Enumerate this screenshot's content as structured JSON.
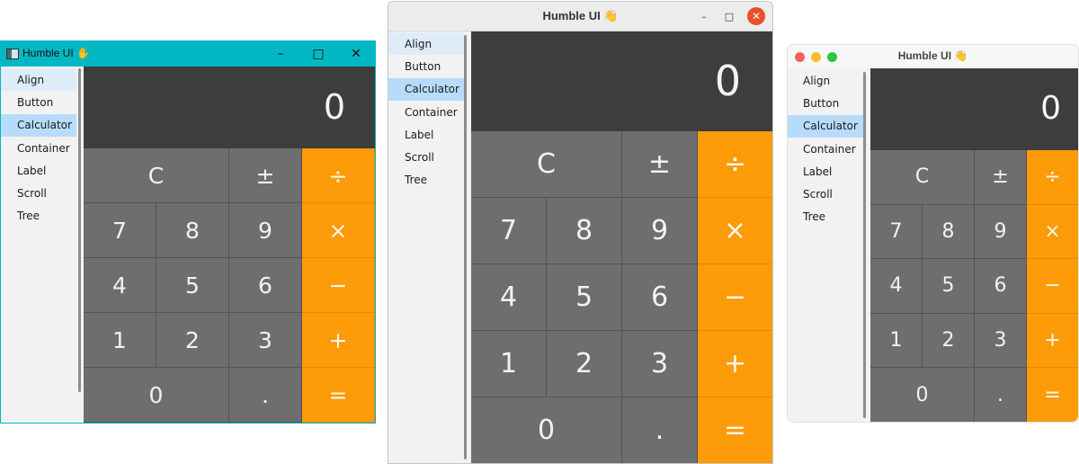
{
  "windows": [
    {
      "title": "Humble UI ✋",
      "controls": [
        "–",
        "□",
        "✕"
      ]
    },
    {
      "title": "Humble UI 👋",
      "controls": [
        "–",
        "□",
        "✕"
      ]
    },
    {
      "title": "Humble UI 👋"
    }
  ],
  "sidebar": {
    "items": [
      {
        "label": "Align"
      },
      {
        "label": "Button"
      },
      {
        "label": "Calculator"
      },
      {
        "label": "Container"
      },
      {
        "label": "Label"
      },
      {
        "label": "Scroll"
      },
      {
        "label": "Tree"
      }
    ],
    "selected": "Calculator",
    "hovered": "Align"
  },
  "calculator": {
    "display": "0",
    "keys": [
      {
        "label": "C",
        "kind": "gray",
        "name": "clear"
      },
      {
        "label": "±",
        "kind": "gray",
        "name": "negate"
      },
      {
        "label": "÷",
        "kind": "orange",
        "name": "divide"
      },
      {
        "label": "7",
        "kind": "gray",
        "name": "digit-7"
      },
      {
        "label": "8",
        "kind": "gray",
        "name": "digit-8"
      },
      {
        "label": "9",
        "kind": "gray",
        "name": "digit-9"
      },
      {
        "label": "×",
        "kind": "orange",
        "name": "multiply"
      },
      {
        "label": "4",
        "kind": "gray",
        "name": "digit-4"
      },
      {
        "label": "5",
        "kind": "gray",
        "name": "digit-5"
      },
      {
        "label": "6",
        "kind": "gray",
        "name": "digit-6"
      },
      {
        "label": "−",
        "kind": "orange",
        "name": "subtract"
      },
      {
        "label": "1",
        "kind": "gray",
        "name": "digit-1"
      },
      {
        "label": "2",
        "kind": "gray",
        "name": "digit-2"
      },
      {
        "label": "3",
        "kind": "gray",
        "name": "digit-3"
      },
      {
        "label": "+",
        "kind": "orange",
        "name": "add"
      },
      {
        "label": "0",
        "kind": "gray",
        "name": "digit-0"
      },
      {
        "label": ".",
        "kind": "gray",
        "name": "decimal"
      },
      {
        "label": "=",
        "kind": "orange",
        "name": "equals"
      }
    ]
  },
  "colors": {
    "operator": "#fe9b09",
    "key": "#6e6e6e",
    "display": "#3d3d3d",
    "selected": "#b7dcfb",
    "hover": "#ddecf8",
    "windows_accent": "#00b7c3",
    "mac_close": "#fe5f57",
    "mac_min": "#febc2e",
    "mac_max": "#28c840"
  }
}
